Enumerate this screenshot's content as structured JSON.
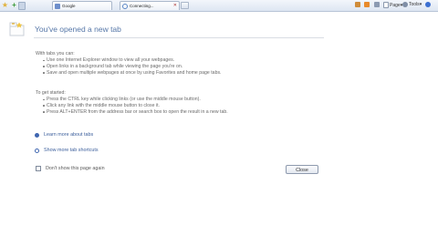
{
  "browser": {
    "tabs": [
      {
        "label": "Google"
      },
      {
        "label": "Connecting..."
      }
    ],
    "toolbar": {
      "page_label": "Page",
      "tools_label": "Tools"
    }
  },
  "page": {
    "heading": "You've opened a new tab",
    "section_tabs": {
      "title": "With tabs you can:",
      "items": [
        "Use one Internet Explorer window to view all your webpages.",
        "Open links in a background tab while viewing the page you're on.",
        "Save and open multiple webpages at once by using Favorites and home page tabs."
      ]
    },
    "section_start": {
      "title": "To get started:",
      "items": [
        "Press the CTRL key while clicking links (or use the middle mouse button).",
        "Click any link with the middle mouse button to close it.",
        "Press ALT+ENTER from the address bar or search box to open the result in a new tab."
      ]
    },
    "links": {
      "learn_more": "Learn more about tabs",
      "shortcuts": "Show more tab shortcuts"
    },
    "dont_show_label": "Don't show this page again",
    "close_label": "Close"
  },
  "colors": {
    "heading": "#5677a8",
    "link": "#3c5f9c",
    "chrome": "#dde6f2"
  }
}
